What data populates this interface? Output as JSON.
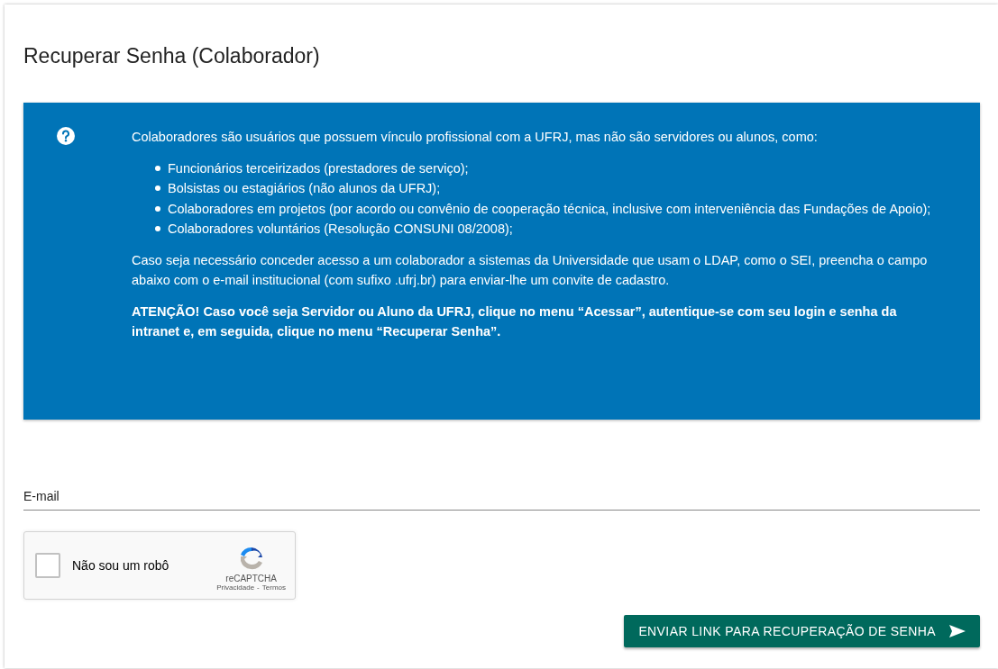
{
  "page": {
    "title": "Recuperar Senha (Colaborador)"
  },
  "info": {
    "intro": "Colaboradores são usuários que possuem vínculo profissional com a UFRJ, mas não são servidores ou alunos, como:",
    "items": [
      "Funcionários terceirizados (prestadores de serviço);",
      "Bolsistas ou estagiários (não alunos da UFRJ);",
      "Colaboradores em projetos (por acordo ou convênio de cooperação técnica, inclusive com interveniência das Fundações de Apoio);",
      "Colaboradores voluntários (Resolução CONSUNI 08/2008);"
    ],
    "paragraphs": [
      {
        "text": "Caso seja necessário conceder acesso a um colaborador a sistemas da Universidade que usam o LDAP, como o SEI, preencha o campo abaixo com o e-mail institucional (com sufixo .ufrj.br) para enviar-lhe um convite de cadastro.",
        "bold": false
      },
      {
        "text": "ATENÇÃO! Caso você seja Servidor ou Aluno da UFRJ, clique no menu “Acessar”, autentique-se com seu login e senha da intranet e, em seguida, clique no menu “Recuperar Senha”.",
        "bold": true
      }
    ]
  },
  "email": {
    "placeholder": "E-mail"
  },
  "captcha": {
    "label": "Não sou um robô",
    "checked": false,
    "brand": "reCAPTCHA",
    "privacy": "Privacidade",
    "separator": "-",
    "terms": "Termos"
  },
  "submit": {
    "label": "ENVIAR LINK PARA RECUPERAÇÃO DE SENHA"
  }
}
